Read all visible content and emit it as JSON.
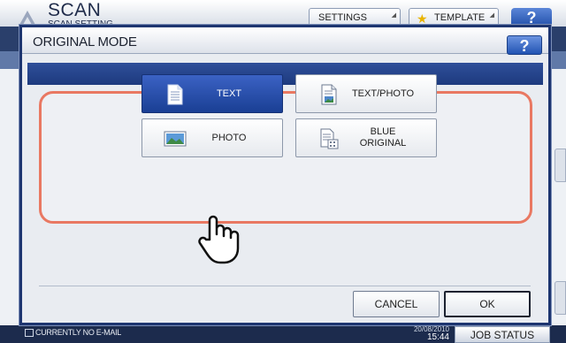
{
  "background": {
    "title": "SCAN",
    "subtitle": "SCAN SETTING",
    "settings_label": "SETTINGS",
    "template_label": "TEMPLATE",
    "help_label": "?",
    "status_message": "CURRENTLY NO E-MAIL",
    "date": "20/08/2010",
    "time": "15:44",
    "job_status_label": "JOB STATUS"
  },
  "dialog": {
    "title": "ORIGINAL MODE",
    "help_label": "?",
    "modes": [
      {
        "label": "TEXT",
        "icon": "text-document-icon",
        "selected": true
      },
      {
        "label": "TEXT/PHOTO",
        "icon": "text-photo-document-icon",
        "selected": false
      },
      {
        "label": "PHOTO",
        "icon": "photo-icon",
        "selected": false
      },
      {
        "label": "BLUE\nORIGINAL",
        "icon": "blue-original-document-icon",
        "selected": false
      }
    ],
    "cancel_label": "CANCEL",
    "ok_label": "OK"
  },
  "colors": {
    "selected_button": "#1f4398",
    "panel_border": "#e97862",
    "dialog_frame": "#1d3570"
  }
}
